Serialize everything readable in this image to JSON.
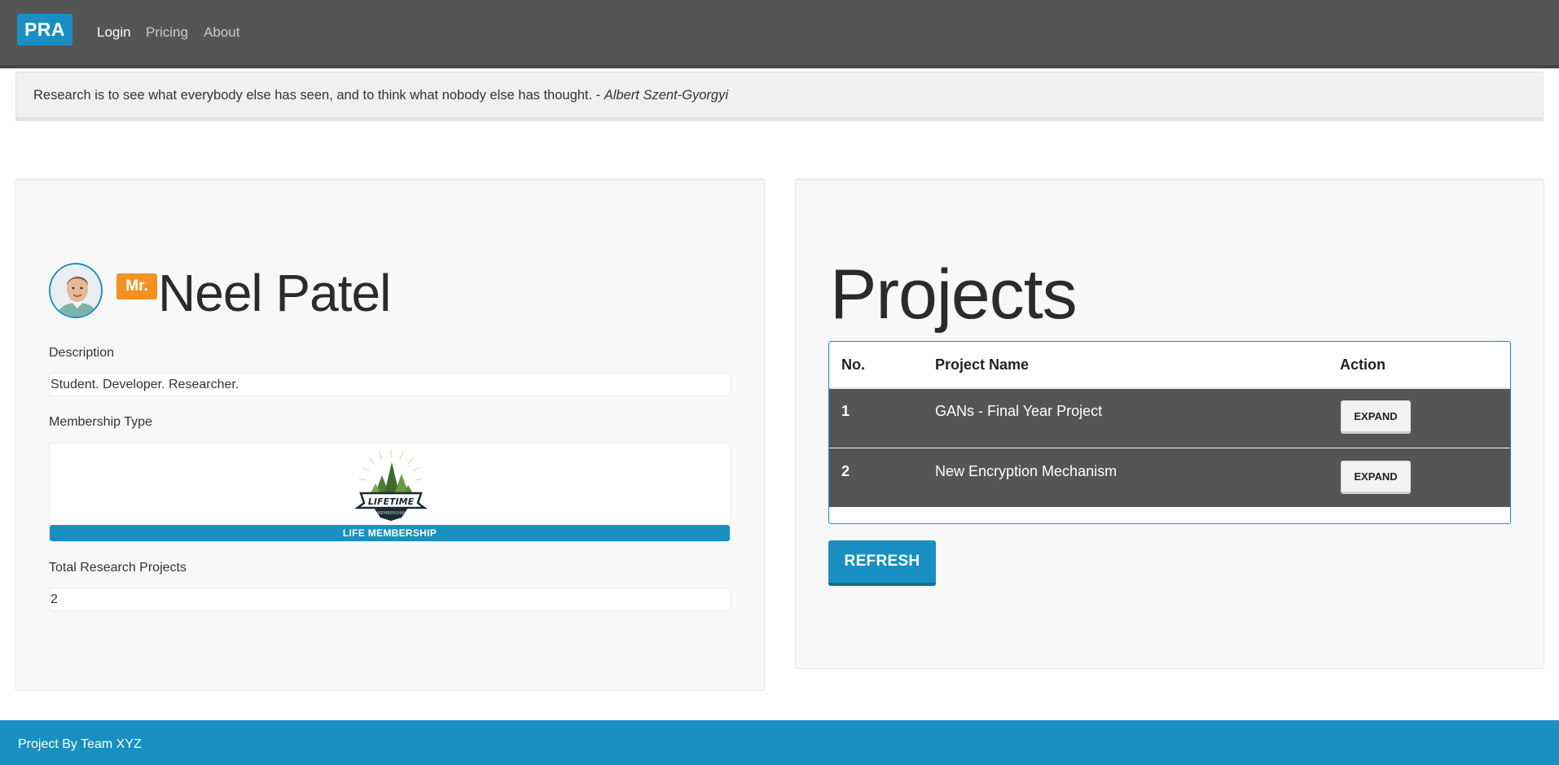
{
  "navbar": {
    "brand": "PRA",
    "links": [
      "Login",
      "Pricing",
      "About"
    ]
  },
  "quote": {
    "text": "Research is to see what everybody else has seen, and to think what nobody else has thought. - ",
    "author": "Albert Szent-Gyorgyi"
  },
  "profile": {
    "title_badge": "Mr.",
    "name": "Neel Patel",
    "description_label": "Description",
    "description_value": "Student. Developer. Researcher.",
    "membership_label": "Membership Type",
    "membership_badge_text": "LIFETIME",
    "membership_badge_subtext": "MEMBERSHIP",
    "membership_value": "LIFE MEMBERSHIP",
    "projects_count_label": "Total Research Projects",
    "projects_count_value": "2"
  },
  "projects": {
    "title": "Projects",
    "columns": [
      "No.",
      "Project Name",
      "Action"
    ],
    "rows": [
      {
        "no": "1",
        "name": "GANs - Final Year Project",
        "action": "EXPAND"
      },
      {
        "no": "2",
        "name": "New Encryption Mechanism",
        "action": "EXPAND"
      }
    ],
    "refresh_label": "REFRESH"
  },
  "footer": {
    "text": "Project By Team XYZ"
  },
  "colors": {
    "navbar": "#555555",
    "accent": "#1a8fc1",
    "badge_orange": "#f39121"
  }
}
